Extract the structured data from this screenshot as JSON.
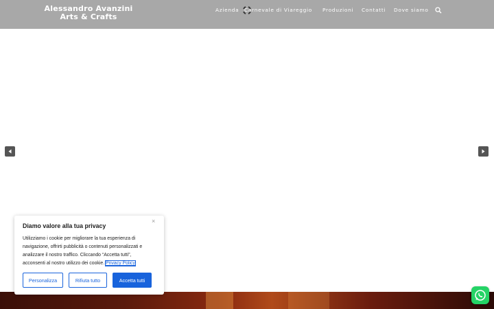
{
  "header": {
    "logo_line1": "Alessandro Avanzini",
    "logo_line2": "Arts & Crafts",
    "background_color": "#a8a8a8"
  },
  "nav": {
    "items": [
      {
        "label": "Azienda"
      },
      {
        "label": "Carnevale di Viareggio"
      },
      {
        "label": "Produzioni"
      },
      {
        "label": "Contatti"
      },
      {
        "label": "Dove siamo"
      }
    ],
    "search_icon": "search-icon"
  },
  "slider": {
    "prev_icon": "chevron-left-icon",
    "next_icon": "chevron-right-icon",
    "loading_icon": "spinner-icon"
  },
  "cookie_banner": {
    "title": "Diamo valore alla tua privacy",
    "body_line1": "Utilizziamo i cookie per migliorare la tua esperienza di",
    "body_line2": "navigazione, offrirti pubblicità o contenuti personalizzati e",
    "body_line3": "analizzare il nostro traffico. Cliccando “Accetta tutti”,",
    "body_line4_prefix": "acconsenti al nostro utilizzo dei cookie. ",
    "privacy_link": "Privacy Policy",
    "close_label": "×",
    "buttons": {
      "customize": "Personalizza",
      "reject": "Rifiuta tutto",
      "accept": "Accetta tutti"
    },
    "accent_color": "#1863dc"
  },
  "whatsapp": {
    "icon": "whatsapp-icon",
    "color": "#25d366"
  }
}
